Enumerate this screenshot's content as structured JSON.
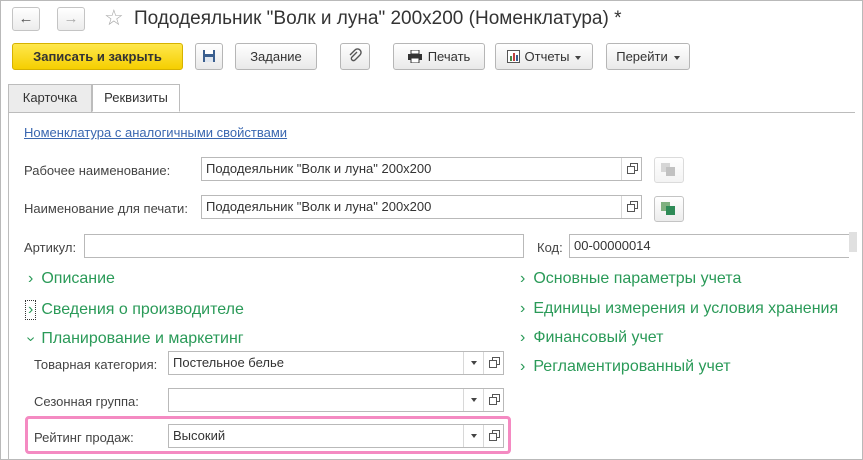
{
  "header": {
    "title": "Пододеяльник \"Волк и луна\" 200х200 (Номенклатура) *"
  },
  "toolbar": {
    "save_close": "Записать и закрыть",
    "task": "Задание",
    "print": "Печать",
    "reports": "Отчеты",
    "goto": "Перейти"
  },
  "tabs": [
    "Карточка",
    "Реквизиты"
  ],
  "form": {
    "similar_link": "Номенклатура с аналогичными свойствами",
    "work_name_label": "Рабочее наименование:",
    "work_name_value": "Пододеяльник \"Волк и луна\" 200х200",
    "print_name_label": "Наименование для печати:",
    "print_name_value": "Пододеяльник \"Волк и луна\" 200х200",
    "article_label": "Артикул:",
    "article_value": "",
    "code_label": "Код:",
    "code_value": "00-00000014"
  },
  "groups_left": [
    "Описание",
    "Сведения о производителе",
    "Планирование и маркетинг"
  ],
  "groups_right": [
    "Основные параметры учета",
    "Единицы измерения и условия хранения",
    "Финансовый учет",
    "Регламентированный учет"
  ],
  "marketing": {
    "category_label": "Товарная категория:",
    "category_value": "Постельное белье",
    "season_label": "Сезонная группа:",
    "season_value": "",
    "rating_label": "Рейтинг продаж:",
    "rating_value": "Высокий"
  },
  "colors": {
    "accent_green": "#2a9a58",
    "primary_yellow": "#f5cf00",
    "highlight_pink": "#f48ac2",
    "link_blue": "#3a67b0"
  }
}
